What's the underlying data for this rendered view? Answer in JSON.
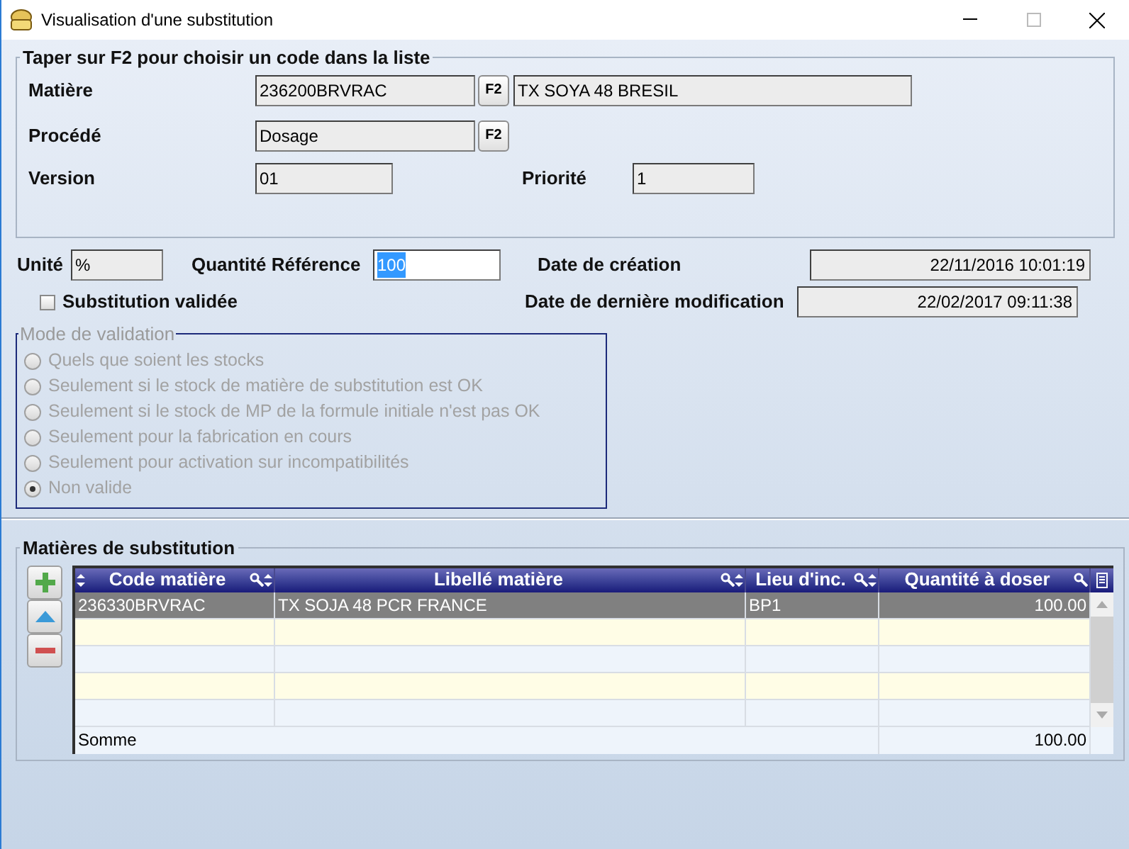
{
  "window": {
    "title": "Visualisation d'une substitution"
  },
  "selection_group": {
    "title": "Taper sur F2 pour choisir un code dans la liste",
    "matiere": {
      "label": "Matière",
      "code": "236200BRVRAC",
      "button": "F2",
      "description": "TX SOYA 48 BRESIL"
    },
    "procede": {
      "label": "Procédé",
      "value": "Dosage",
      "button": "F2"
    },
    "version": {
      "label": "Version",
      "value": "01"
    },
    "priorite": {
      "label": "Priorité",
      "value": "1"
    }
  },
  "unite": {
    "label": "Unité",
    "value": "%"
  },
  "quantite_reference": {
    "label": "Quantité Référence",
    "value": "100"
  },
  "date_creation": {
    "label": "Date de création",
    "value": "22/11/2016 10:01:19"
  },
  "date_modification": {
    "label": "Date de dernière modification",
    "value": "22/02/2017 09:11:38"
  },
  "substitution_validee": {
    "label": "Substitution validée",
    "checked": false
  },
  "mode_validation": {
    "title": "Mode de validation",
    "disabled": true,
    "options": [
      {
        "label": "Quels que soient les stocks",
        "selected": false
      },
      {
        "label": "Seulement si le stock de matière de substitution est OK",
        "selected": false
      },
      {
        "label": "Seulement si le stock de MP de la formule initiale n'est pas OK",
        "selected": false
      },
      {
        "label": "Seulement pour la fabrication en cours",
        "selected": false
      },
      {
        "label": "Seulement pour activation sur incompatibilités",
        "selected": false
      },
      {
        "label": "Non valide",
        "selected": true
      }
    ]
  },
  "substitutions": {
    "title": "Matières de substitution",
    "columns": [
      {
        "label": "Code matière"
      },
      {
        "label": "Libellé matière"
      },
      {
        "label": "Lieu d'inc."
      },
      {
        "label": "Quantité à doser"
      }
    ],
    "rows": [
      {
        "cells": [
          "236330BRVRAC",
          "TX SOJA 48 PCR FRANCE",
          "BP1",
          "100.00"
        ],
        "selected": true
      }
    ],
    "footer": {
      "label": "Somme",
      "total": "100.00"
    }
  }
}
